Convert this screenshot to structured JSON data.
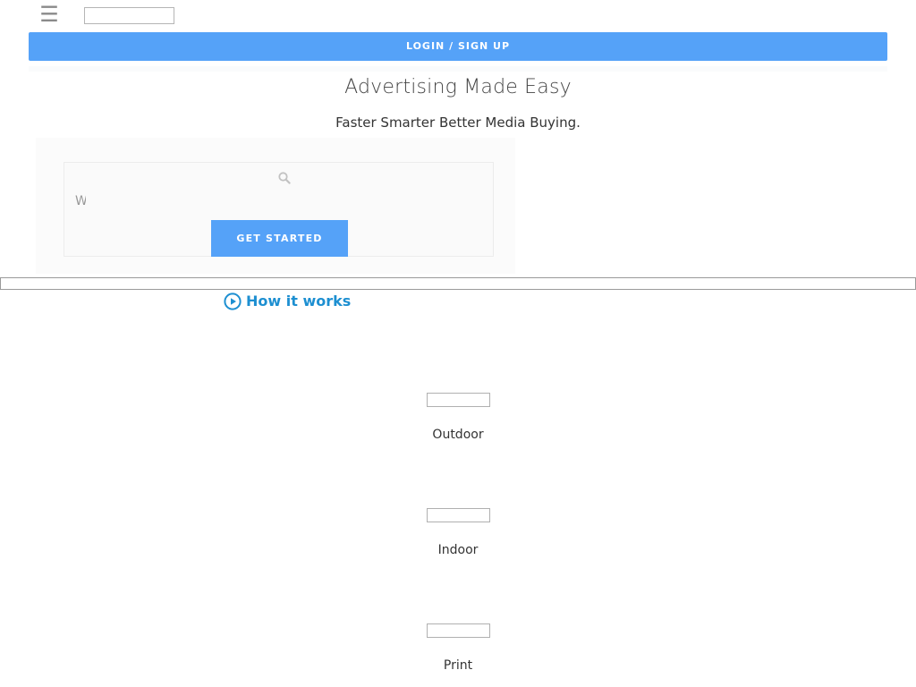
{
  "header": {
    "menu_icon": "hamburger-menu-icon",
    "login_label": "LOGIN / SIGN UP"
  },
  "hero": {
    "title": "Advertising Made Easy",
    "subtitle": "Faster Smarter Better Media Buying."
  },
  "search": {
    "icon": "search-icon",
    "input_value": "W",
    "button_label": "GET STARTED"
  },
  "how_it_works": {
    "icon": "play-circle-icon",
    "label": "How it works"
  },
  "categories": [
    {
      "label": "Outdoor"
    },
    {
      "label": "Indoor"
    },
    {
      "label": "Print"
    }
  ],
  "colors": {
    "accent": "#55a2f8",
    "link": "#1d8fd1"
  }
}
